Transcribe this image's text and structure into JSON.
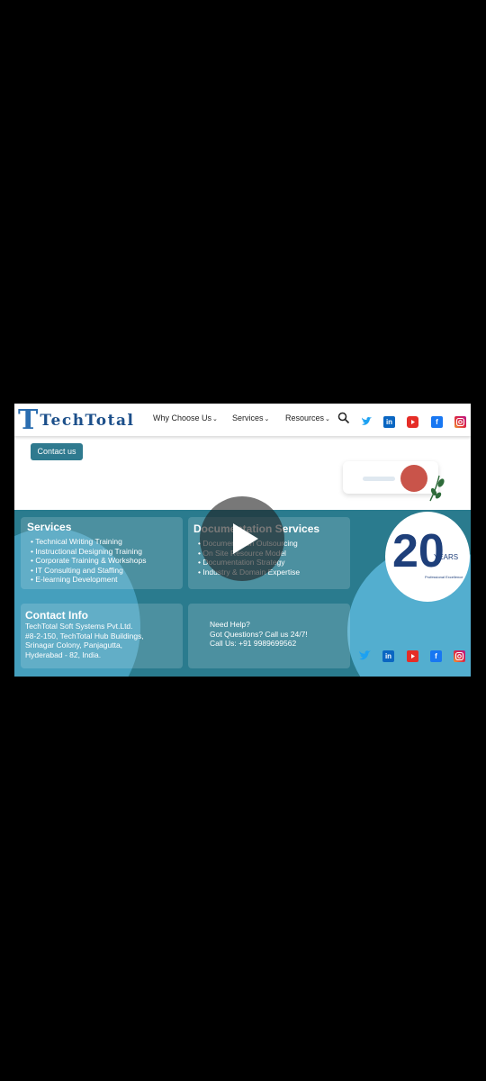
{
  "header": {
    "logo_letter": "T",
    "logo_text": "TechTotal",
    "nav": [
      "Why Choose Us",
      "Services",
      "Resources"
    ],
    "chevron": "⌄"
  },
  "hero": {
    "contact_button": "Contact us"
  },
  "services": {
    "title": "Services",
    "items": [
      "Technical Writing Training",
      "Instructional Designing Training",
      "Corporate Training & Workshops",
      "IT Consulting and Staffing",
      "E-learning Development"
    ]
  },
  "documentation": {
    "title": "Documentation Services",
    "items": [
      "Documentation Outsourcing",
      "On Site Resource Model",
      "Documentation Strategy",
      "Industry & Domain Expertise"
    ]
  },
  "contact_info": {
    "title": "Contact Info",
    "lines": [
      "TechTotal Soft Systems Pvt.Ltd.",
      "#8-2-150, TechTotal Hub Buildings,",
      "Srinagar Colony, Panjagutta,",
      "Hyderabad - 82, India."
    ]
  },
  "help": {
    "lines": [
      "Need Help?",
      "Got Questions? Call us 24/7!",
      "Call Us: +91 9989699562"
    ]
  },
  "badge": {
    "number": "20",
    "word": "YEARS",
    "caption": "Professional Excellence"
  },
  "icons": {
    "linkedin": "in",
    "facebook": "f"
  },
  "colors": {
    "brand_blue": "#1c4f8a",
    "footer_teal": "#2a7b8e",
    "youtube_red": "#e52d27",
    "linkedin_blue": "#0a66c2",
    "facebook_blue": "#1877f2",
    "twitter_blue": "#1da1f2"
  }
}
